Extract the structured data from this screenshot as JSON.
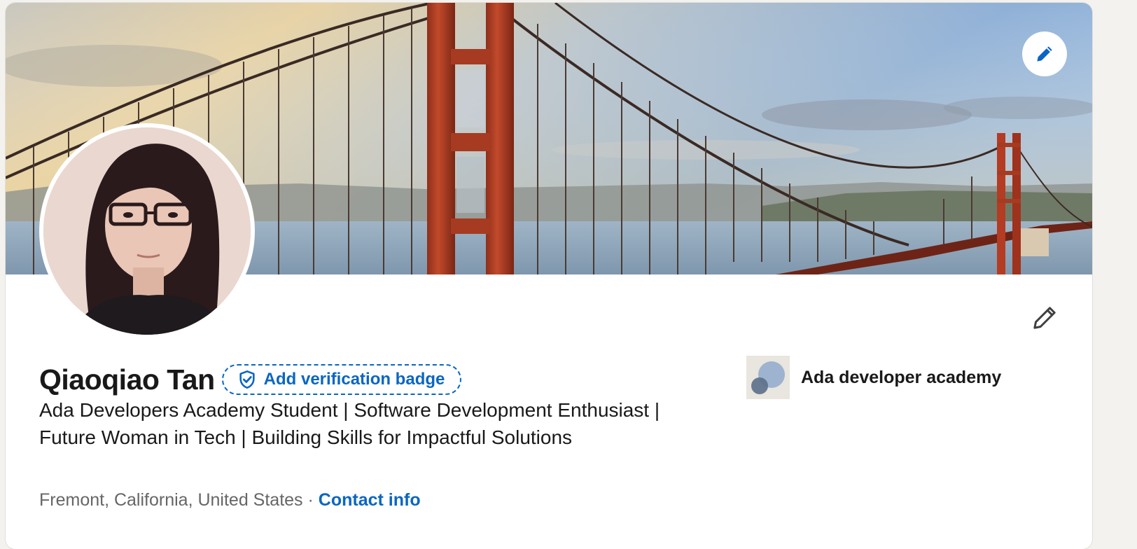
{
  "profile": {
    "name": "Qiaoqiao Tan",
    "verification_label": "Add verification badge",
    "headline": "Ada Developers Academy Student | Software Development Enthusiast | Future Woman in Tech | Building Skills for Impactful Solutions",
    "location": "Fremont, California, United States",
    "separator": " · ",
    "contact_label": "Contact info"
  },
  "organization": {
    "name": "Ada developer academy"
  },
  "icons": {
    "banner_edit": "pencil-icon",
    "intro_edit": "pencil-outline-icon",
    "verify": "shield-check-icon"
  },
  "colors": {
    "accent": "#0a66c2",
    "text_primary": "#191919",
    "text_secondary": "#666666",
    "page_bg": "#f4f2ee",
    "bridge": "#a93a22"
  }
}
